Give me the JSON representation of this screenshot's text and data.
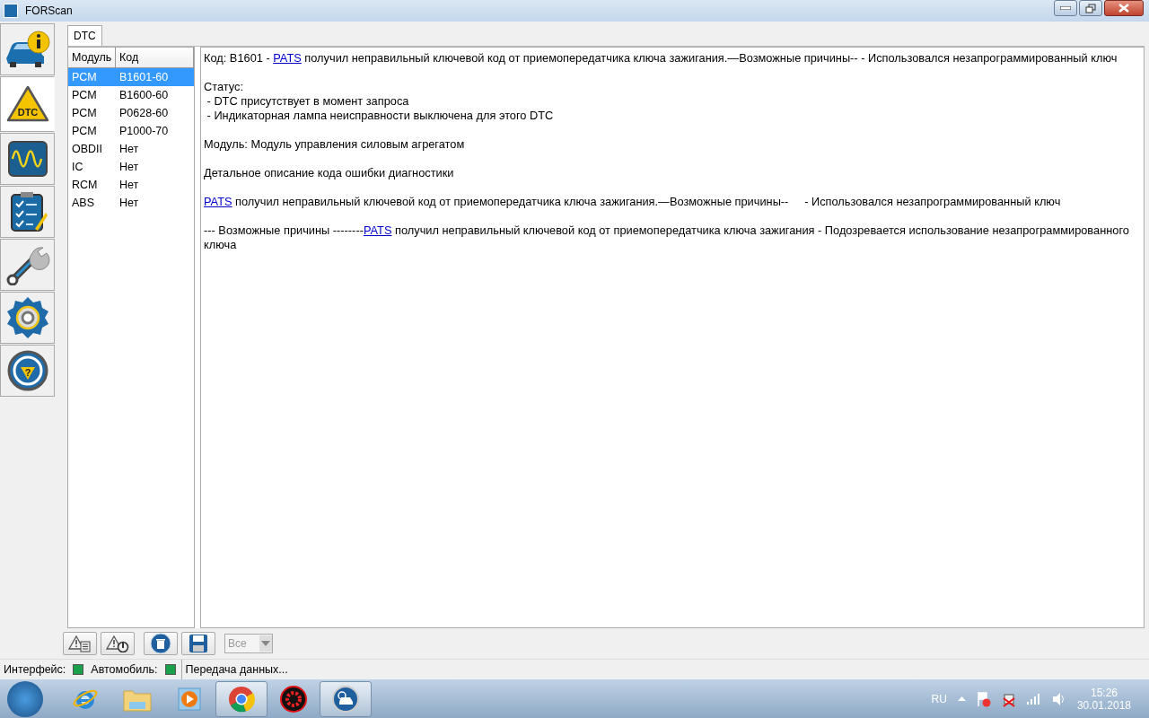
{
  "window": {
    "title": "FORScan"
  },
  "sidebar": {
    "items": [
      {
        "kind": "info",
        "selected": false
      },
      {
        "kind": "dtc",
        "selected": true,
        "badge": "DTC"
      },
      {
        "kind": "oscilloscope",
        "selected": false
      },
      {
        "kind": "checklist",
        "selected": false
      },
      {
        "kind": "wrench",
        "selected": false
      },
      {
        "kind": "gear",
        "selected": false
      },
      {
        "kind": "wheel",
        "selected": false,
        "badge": "?"
      }
    ]
  },
  "tabs": [
    {
      "label": "DTC",
      "selected": true
    }
  ],
  "table": {
    "columns": [
      "Модуль",
      "Код"
    ],
    "rows": [
      {
        "module": "PCM",
        "code": "B1601-60",
        "selected": true
      },
      {
        "module": "PCM",
        "code": "B1600-60",
        "selected": false
      },
      {
        "module": "PCM",
        "code": "P0628-60",
        "selected": false
      },
      {
        "module": "PCM",
        "code": "P1000-70",
        "selected": false
      },
      {
        "module": "OBDII",
        "code": "Нет",
        "selected": false
      },
      {
        "module": "IC",
        "code": "Нет",
        "selected": false
      },
      {
        "module": "RCM",
        "code": "Нет",
        "selected": false
      },
      {
        "module": "ABS",
        "code": "Нет",
        "selected": false
      }
    ]
  },
  "details": {
    "blocks": [
      [
        [
          {
            "kind": "text",
            "text": "Код: B1601 - "
          },
          {
            "kind": "link",
            "text": "PATS"
          },
          {
            "kind": "text",
            "text": " получил неправильный ключевой код от приемопередатчика ключа зажигания.—Возможные причины-- - Использовался незапрограммированный ключ"
          }
        ]
      ],
      [
        [
          {
            "kind": "text",
            "text": "Статус:"
          }
        ],
        [
          {
            "kind": "text",
            "text": " - DTC присутствует в момент запроса"
          }
        ],
        [
          {
            "kind": "text",
            "text": " - Индикаторная лампа неисправности выключена для этого DTC"
          }
        ]
      ],
      [
        [
          {
            "kind": "text",
            "text": "Модуль: Модуль управления силовым агрегатом"
          }
        ]
      ],
      [
        [
          {
            "kind": "text",
            "text": "Детальное описание кода ошибки диагностики"
          }
        ]
      ],
      [
        [
          {
            "kind": "link",
            "text": "PATS"
          },
          {
            "kind": "text",
            "text": " получил неправильный ключевой код от приемопередатчика ключа зажигания.—Возможные причины--     - Использовался незапрограммированный ключ"
          }
        ]
      ],
      [
        [
          {
            "kind": "text",
            "text": "--- Возможные причины --------"
          },
          {
            "kind": "link",
            "text": "PATS"
          },
          {
            "kind": "text",
            "text": " получил неправильный ключевой код от приемопередатчика ключа зажигания - Подозревается использование незапрограммированного ключа"
          }
        ]
      ]
    ]
  },
  "toolbar": {
    "buttons": [
      {
        "kind": "warning-doc"
      },
      {
        "kind": "warning-plug"
      },
      {
        "kind": "delete"
      },
      {
        "kind": "save"
      }
    ],
    "filter": {
      "value": "Все",
      "disabled": true
    }
  },
  "status_bar": {
    "interface_label": "Интерфейс:",
    "interface_ok": true,
    "vehicle_label": "Автомобиль:",
    "vehicle_ok": true,
    "message": "Передача данных..."
  },
  "taskbar": {
    "apps": [
      {
        "kind": "ie",
        "running": false
      },
      {
        "kind": "folder",
        "running": false
      },
      {
        "kind": "player",
        "running": false
      },
      {
        "kind": "chrome",
        "running": true
      },
      {
        "kind": "driver",
        "running": false
      },
      {
        "kind": "forscan",
        "running": true
      }
    ],
    "language": "RU",
    "time": "15:26",
    "date": "30.01.2018"
  }
}
